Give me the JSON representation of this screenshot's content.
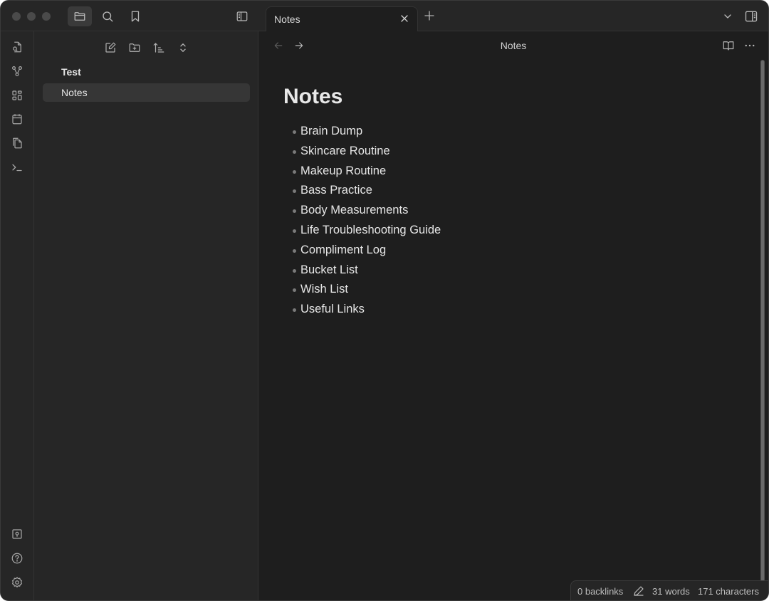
{
  "window": {
    "traffic_lights": [
      "close",
      "minimize",
      "zoom"
    ]
  },
  "left_toolbar": {
    "icons": [
      {
        "name": "folder-icon",
        "label": "Files",
        "active": true
      },
      {
        "name": "search-icon",
        "label": "Search",
        "active": false
      },
      {
        "name": "bookmark-icon",
        "label": "Bookmarks",
        "active": false
      }
    ],
    "toggle_sidebar_icon": "sidebar-left-icon"
  },
  "tabs": {
    "items": [
      {
        "label": "Notes",
        "active": true
      }
    ],
    "new_tab_icon": "plus-icon",
    "tab_list_icon": "chevron-down-icon",
    "toggle_right_sidebar_icon": "sidebar-right-icon"
  },
  "ribbon": {
    "top_icons": [
      "quick-switcher-icon",
      "graph-view-icon",
      "canvas-icon",
      "daily-note-icon",
      "templates-icon",
      "command-palette-icon"
    ],
    "bottom_icons": [
      "vault-icon",
      "help-icon",
      "settings-icon"
    ]
  },
  "explorer": {
    "tools": [
      "new-note-icon",
      "new-folder-icon",
      "sort-icon",
      "collapse-icon"
    ],
    "tree": [
      {
        "type": "folder",
        "label": "Test"
      },
      {
        "type": "file",
        "label": "Notes",
        "selected": true
      }
    ]
  },
  "editor": {
    "nav": {
      "back_enabled": false,
      "forward_enabled": true
    },
    "header_title": "Notes",
    "title": "Notes",
    "list": [
      "Brain Dump",
      "Skincare Routine",
      "Makeup Routine",
      "Bass Practice",
      "Body Measurements",
      "Life Troubleshooting Guide",
      "Compliment Log",
      "Bucket List",
      "Wish List",
      "Useful Links"
    ]
  },
  "status": {
    "backlinks": "0 backlinks",
    "words": "31 words",
    "characters": "171 characters"
  }
}
